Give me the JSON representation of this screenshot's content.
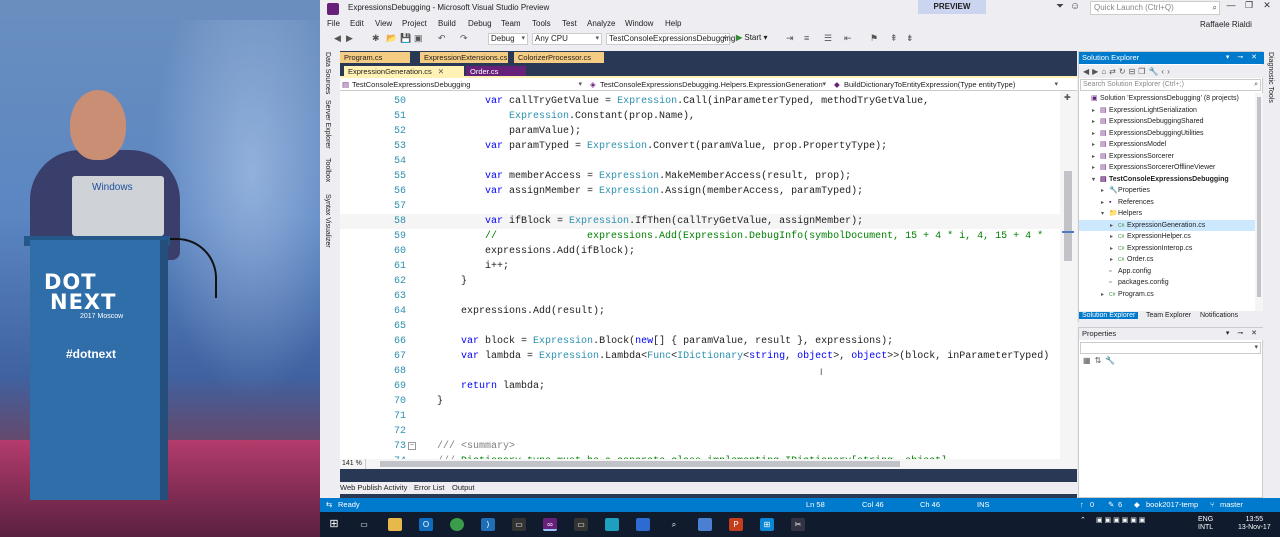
{
  "stage": {
    "laptop_label": "Windows",
    "brand_line1": "DOT",
    "brand_line2": "NEXT",
    "brand_sub": "2017 Moscow",
    "hashtag": "#dotnext"
  },
  "window": {
    "title": "ExpressionsDebugging - Microsoft Visual Studio Preview",
    "badge": "PREVIEW",
    "quick_launch_placeholder": "Quick Launch (Ctrl+Q)",
    "user": "Raffaele Rialdi"
  },
  "menu": [
    "File",
    "Edit",
    "View",
    "Project",
    "Build",
    "Debug",
    "Team",
    "Tools",
    "Test",
    "Analyze",
    "Window",
    "Help"
  ],
  "toolbar": {
    "config": "Debug",
    "platform": "Any CPU",
    "startup_project": "TestConsoleExpressionsDebugging",
    "start_label": "Start"
  },
  "left_strip": [
    "Data Sources",
    "Server Explorer",
    "Toolbox",
    "Syntax Visualizer"
  ],
  "right_strip": [
    "Diagnostic Tools"
  ],
  "doc_tabs_row1": [
    {
      "label": "Program.cs",
      "style": "yellow"
    },
    {
      "label": "ExpressionExtensions.cs",
      "style": "yellow"
    },
    {
      "label": "ColorizerProcessor.cs",
      "style": "yellow"
    }
  ],
  "doc_tabs_row2": [
    {
      "label": "ExpressionGeneration.cs",
      "style": "active"
    },
    {
      "label": "Order.cs",
      "style": "preview"
    }
  ],
  "navbar": {
    "project": "TestConsoleExpressionsDebugging",
    "type": "TestConsoleExpressionsDebugging.Helpers.ExpressionGeneration",
    "member": "BuildDictionaryToEntityExpression(Type entityType)"
  },
  "code_lines": [
    {
      "n": "50",
      "html": "        <span class=\"kw\">var</span> callTryGetValue = <span class=\"ty\">Expression</span>.Call(inParameterTyped, methodTryGetValue,"
    },
    {
      "n": "51",
      "html": "            <span class=\"ty\">Expression</span>.Constant(prop.Name),"
    },
    {
      "n": "52",
      "html": "            paramValue);"
    },
    {
      "n": "53",
      "html": "        <span class=\"kw\">var</span> paramTyped = <span class=\"ty\">Expression</span>.Convert(paramValue, prop.PropertyType);"
    },
    {
      "n": "54",
      "html": ""
    },
    {
      "n": "55",
      "html": "        <span class=\"kw\">var</span> memberAccess = <span class=\"ty\">Expression</span>.MakeMemberAccess(result, prop);"
    },
    {
      "n": "56",
      "html": "        <span class=\"kw\">var</span> assignMember = <span class=\"ty\">Expression</span>.Assign(memberAccess, paramTyped);"
    },
    {
      "n": "57",
      "html": ""
    },
    {
      "n": "58",
      "html": "        <span class=\"kw\">var</span> ifBlock = <span class=\"ty\">Expression</span>.IfThen(callTryGetValue, assignMember);"
    },
    {
      "n": "59",
      "html": "        <span class=\"cm\">//               expressions.Add(Expression.DebugInfo(symbolDocument, 15 + 4 * i, 4, 15 + 4 *</span>"
    },
    {
      "n": "60",
      "html": "        expressions.Add(ifBlock);"
    },
    {
      "n": "61",
      "html": "        i++;"
    },
    {
      "n": "62",
      "html": "    }"
    },
    {
      "n": "63",
      "html": ""
    },
    {
      "n": "64",
      "html": "    expressions.Add(result);"
    },
    {
      "n": "65",
      "html": ""
    },
    {
      "n": "66",
      "html": "    <span class=\"kw\">var</span> block = <span class=\"ty\">Expression</span>.Block(<span class=\"kw\">new</span>[] { paramValue, result }, expressions);"
    },
    {
      "n": "67",
      "html": "    <span class=\"kw\">var</span> lambda = <span class=\"ty\">Expression</span>.Lambda&lt;<span class=\"ty\">Func</span>&lt;<span class=\"ty\">IDictionary</span>&lt;<span class=\"kw\">string</span>, <span class=\"kw\">object</span>&gt;, <span class=\"kw\">object</span>&gt;&gt;(block, inParameterTyped)"
    },
    {
      "n": "68",
      "html": ""
    },
    {
      "n": "69",
      "html": "    <span class=\"kw\">return</span> lambda;"
    },
    {
      "n": "70",
      "html": "}"
    },
    {
      "n": "71",
      "html": ""
    },
    {
      "n": "72",
      "html": ""
    },
    {
      "n": "73",
      "html": "<span class=\"gy\">///</span> <span class=\"gy\">&lt;summary&gt;</span>"
    },
    {
      "n": "74",
      "html": "<span class=\"gy\">///</span> <span class=\"cm\">Dictionary type must be a concrete class implementing IDictionary[string, object]</span>"
    }
  ],
  "zoom": "141 %",
  "bottom_tabs": [
    "Web Publish Activity",
    "Error List",
    "Output"
  ],
  "solution_explorer": {
    "title": "Solution Explorer",
    "search_placeholder": "Search Solution Explorer (Ctrl+;)",
    "nodes": [
      {
        "label": "Solution 'ExpressionsDebugging' (8 projects)",
        "indent": 0,
        "exp": "",
        "icon": "▣"
      },
      {
        "label": "ExpressionLightSerialization",
        "indent": 1,
        "exp": "▸",
        "icon": "▤"
      },
      {
        "label": "ExpressionsDebuggingShared",
        "indent": 1,
        "exp": "▸",
        "icon": "▤"
      },
      {
        "label": "ExpressionsDebuggingUtilities",
        "indent": 1,
        "exp": "▸",
        "icon": "▤"
      },
      {
        "label": "ExpressionsModel",
        "indent": 1,
        "exp": "▸",
        "icon": "▤"
      },
      {
        "label": "ExpressionsSorcerer",
        "indent": 1,
        "exp": "▸",
        "icon": "▤"
      },
      {
        "label": "ExpressionsSorcererOfflineViewer",
        "indent": 1,
        "exp": "▸",
        "icon": "▤"
      },
      {
        "label": "TestConsoleExpressionsDebugging",
        "indent": 1,
        "exp": "▾",
        "icon": "▤",
        "bold": true
      },
      {
        "label": "Properties",
        "indent": 2,
        "exp": "▸",
        "icon": "🔧"
      },
      {
        "label": "References",
        "indent": 2,
        "exp": "▸",
        "icon": "▪"
      },
      {
        "label": "Helpers",
        "indent": 2,
        "exp": "▾",
        "icon": "📁"
      },
      {
        "label": "ExpressionGeneration.cs",
        "indent": 3,
        "exp": "▸",
        "icon": "C#",
        "sel": true
      },
      {
        "label": "ExpressionHelper.cs",
        "indent": 3,
        "exp": "▸",
        "icon": "C#"
      },
      {
        "label": "ExpressionInterop.cs",
        "indent": 3,
        "exp": "▸",
        "icon": "C#"
      },
      {
        "label": "Order.cs",
        "indent": 3,
        "exp": "▸",
        "icon": "C#"
      },
      {
        "label": "App.config",
        "indent": 2,
        "exp": "",
        "icon": "▫"
      },
      {
        "label": "packages.config",
        "indent": 2,
        "exp": "",
        "icon": "▫"
      },
      {
        "label": "Program.cs",
        "indent": 2,
        "exp": "▸",
        "icon": "C#"
      }
    ],
    "bottom_tabs": [
      "Solution Explorer",
      "Team Explorer",
      "Notifications"
    ]
  },
  "properties": {
    "title": "Properties"
  },
  "statusbar": {
    "state": "Ready",
    "ln": "Ln 58",
    "col": "Col 46",
    "ch": "Ch 46",
    "mode": "INS",
    "up": "0",
    "edits": "6",
    "repo": "book2017-temp",
    "branch": "master"
  },
  "taskbar": {
    "lang": "ENG",
    "layout": "INTL",
    "time": "13:55",
    "date": "13-Nov-17"
  }
}
